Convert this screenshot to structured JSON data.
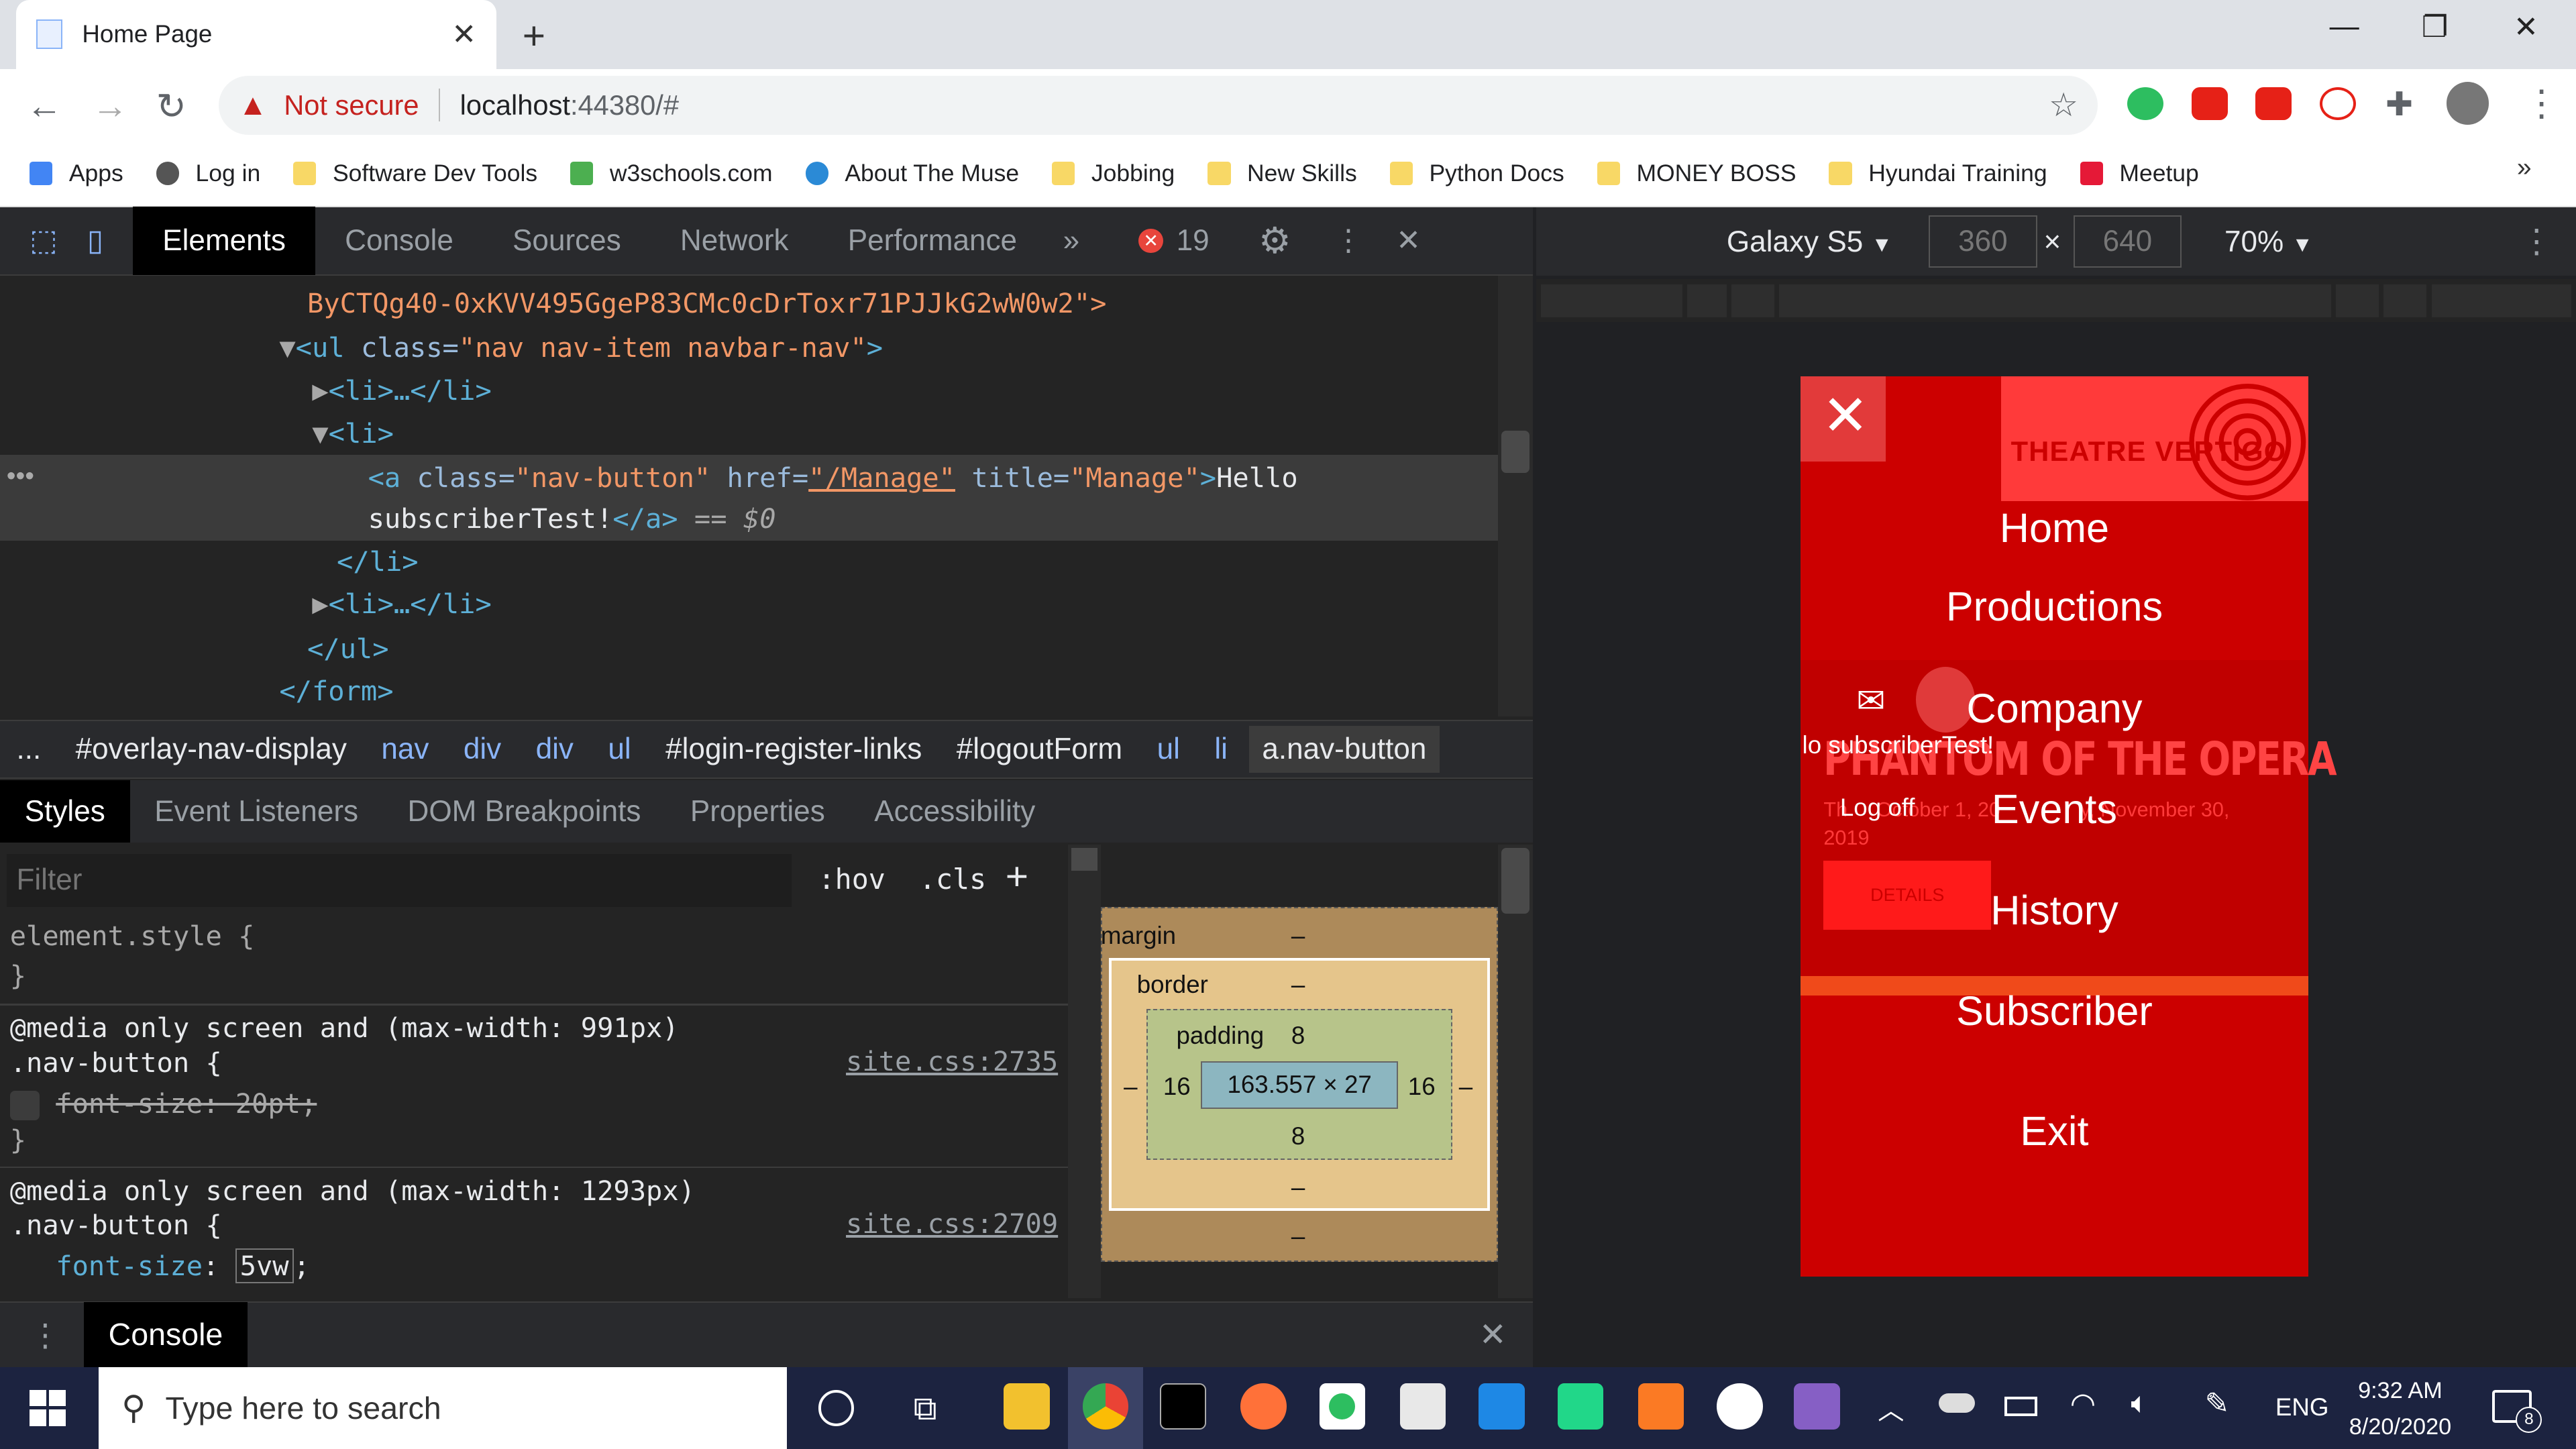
{
  "browser": {
    "tab_title": "Home Page",
    "not_secure": "Not secure",
    "url_host": "localhost",
    "url_path": ":44380/#"
  },
  "bookmarks": [
    {
      "label": "Apps",
      "icon": "apps-grid-icon"
    },
    {
      "label": "Log in",
      "icon": "globe-icon"
    },
    {
      "label": "Software Dev Tools",
      "icon": "folder-icon"
    },
    {
      "label": "w3schools.com",
      "icon": "w3schools-icon"
    },
    {
      "label": "About The Muse",
      "icon": "muse-icon"
    },
    {
      "label": "Jobbing",
      "icon": "folder-icon"
    },
    {
      "label": "New Skills",
      "icon": "folder-icon"
    },
    {
      "label": "Python Docs",
      "icon": "folder-icon"
    },
    {
      "label": "MONEY BOSS",
      "icon": "folder-icon"
    },
    {
      "label": "Hyundai Training",
      "icon": "folder-icon"
    },
    {
      "label": "Meetup",
      "icon": "meetup-icon"
    }
  ],
  "devtools": {
    "tabs": [
      "Elements",
      "Console",
      "Sources",
      "Network",
      "Performance"
    ],
    "error_count": "19",
    "elements": {
      "l0": "ByCTQg40-0xKVV495GgeP83CMc0cDrToxr71PJJkG2wW0w2\">",
      "l1_open": "<ul ",
      "l1_attr": "class=",
      "l1_val": "\"nav nav-item navbar-nav\"",
      "l1_close": ">",
      "l2": "<li>…</li>",
      "l3": "<li>",
      "l4_a": "<a ",
      "l4_class": "class=",
      "l4_classval": "\"nav-button\"",
      "l4_href": " href=",
      "l4_hrefval": "\"/Manage\"",
      "l4_title": " title=",
      "l4_titleval": "\"Manage\"",
      "l4_gt": ">",
      "l4_text": "Hello",
      "l5_text": "subscriberTest!",
      "l5_end": "</a>",
      "l5_eq": " == $0",
      "l6": "</li>",
      "l7": "<li>…</li>",
      "l8": "</ul>",
      "l9": "</form>"
    },
    "breadcrumbs": [
      "...",
      "#overlay-nav-display",
      "nav",
      "div",
      "div",
      "ul",
      "#login-register-links",
      "#logoutForm",
      "ul",
      "li",
      "a.nav-button"
    ],
    "subtabs": [
      "Styles",
      "Event Listeners",
      "DOM Breakpoints",
      "Properties",
      "Accessibility"
    ],
    "filter_placeholder": "Filter",
    "hov": ":hov",
    "cls": ".cls",
    "styles": {
      "element_style": "element.style {",
      "close": "}",
      "media1": "@media only screen and (max-width: 991px)",
      "sel1": ".nav-button {",
      "src1": "site.css:2735",
      "prop1": "font-size",
      "val1": " 20pt;",
      "media2": "@media only screen and (max-width: 1293px)",
      "sel2": ".nav-button {",
      "src2": "site.css:2709",
      "prop2": "font-size",
      "val2": "5vw",
      "semi": ";"
    },
    "boxmodel": {
      "margin": "margin",
      "border": "border",
      "padding": "padding",
      "dash": "–",
      "pad_top": "8",
      "pad_bottom": "8",
      "pad_left": "16",
      "pad_right": "16",
      "content": "163.557 × 27"
    },
    "drawer_tab": "Console"
  },
  "emulation": {
    "device": "Galaxy S5",
    "width": "360",
    "height": "640",
    "zoom": "70%"
  },
  "phone_page": {
    "logo_text": "THEATRE VERTIGO",
    "nav": [
      "Home",
      "Productions",
      "Company",
      "Events",
      "History",
      "Subscriber",
      "Exit"
    ],
    "user_text": "lo subscriberTest!",
    "logoff": "Log off",
    "show_title": "PHANTOM OF THE OPERA",
    "dates": "Th     October 1, 20              y, November 30,",
    "year": "2019",
    "details": "DETAILS"
  },
  "taskbar": {
    "search_placeholder": "Type here to search",
    "lang": "ENG",
    "time": "9:32 AM",
    "date": "8/20/2020",
    "notifications": "8"
  },
  "colors": {
    "phone_red": "#cc0000",
    "devtools_bg": "#242424",
    "tag_blue": "#5db0d7",
    "value_orange": "#f29766"
  }
}
